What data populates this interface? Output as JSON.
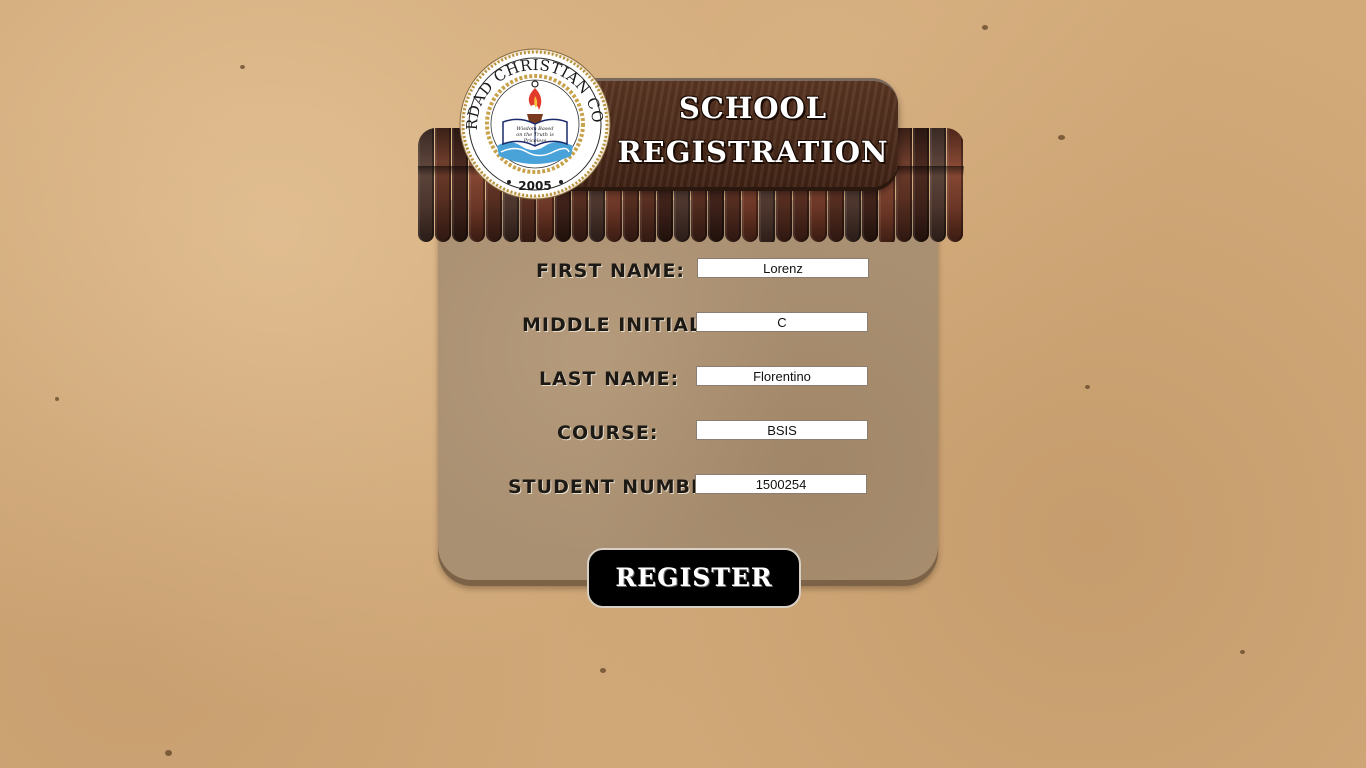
{
  "header": {
    "title_line1": "SCHOOL",
    "title_line2": "REGISTRATION"
  },
  "logo": {
    "ring_text": "LA VERDAD CHRISTIAN COLLEGE",
    "motto_line1": "Wisdom Based",
    "motto_line2": "on the Truth is",
    "motto_line3": "Priceless",
    "year": "2005"
  },
  "form": {
    "first_name": {
      "label": "FIRST NAME:",
      "value": "Lorenz"
    },
    "middle_initial": {
      "label": "MIDDLE INITIAL:",
      "value": "C"
    },
    "last_name": {
      "label": "LAST NAME:",
      "value": "Florentino"
    },
    "course": {
      "label": "COURSE:",
      "value": "BSIS"
    },
    "student_number": {
      "label": "STUDENT NUMBER:",
      "value": "1500254"
    }
  },
  "register_button": {
    "label": "REGISTER"
  },
  "colors": {
    "background": "#d2aa7a",
    "panel": "#aa9072",
    "banner": "#4a2b1a",
    "button": "#000000"
  }
}
